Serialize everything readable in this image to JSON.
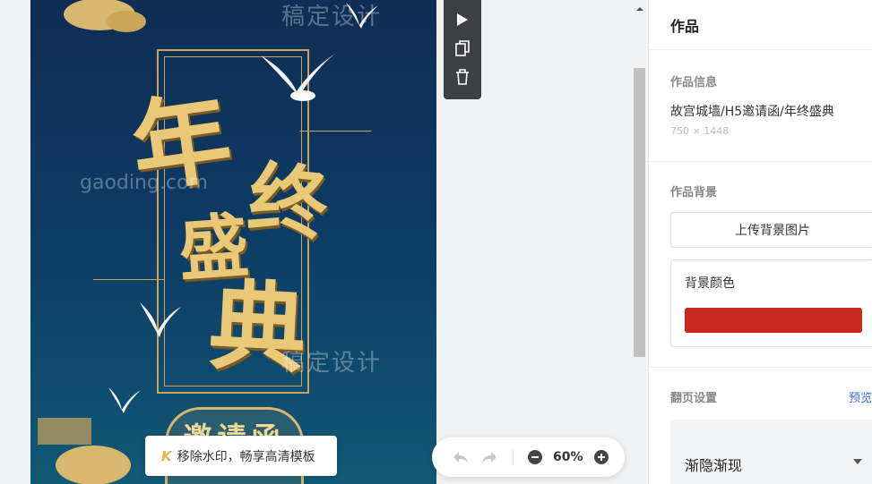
{
  "poster": {
    "title_chars": [
      "年",
      "终",
      "盛",
      "典"
    ],
    "invite_text": "邀请函",
    "watermark_cn": "稿定设计",
    "watermark_en": "gaoding.com"
  },
  "float_toolbar": {
    "icons": [
      "play-icon",
      "copy-icon",
      "trash-icon"
    ]
  },
  "remove_watermark": {
    "label": "移除水印，畅享高清模板"
  },
  "zoom": {
    "percent": "60%"
  },
  "panel": {
    "header": "作品",
    "info": {
      "title": "作品信息",
      "name": "故宫城墙/H5邀请函/年终盛典",
      "size": "750 × 1448"
    },
    "background": {
      "title": "作品背景",
      "upload_label": "上传背景图片",
      "color_label": "背景颜色",
      "color": "#c9291c"
    },
    "flip": {
      "title": "翻页设置",
      "preview_label": "预览",
      "selected": "渐隐渐现"
    }
  }
}
